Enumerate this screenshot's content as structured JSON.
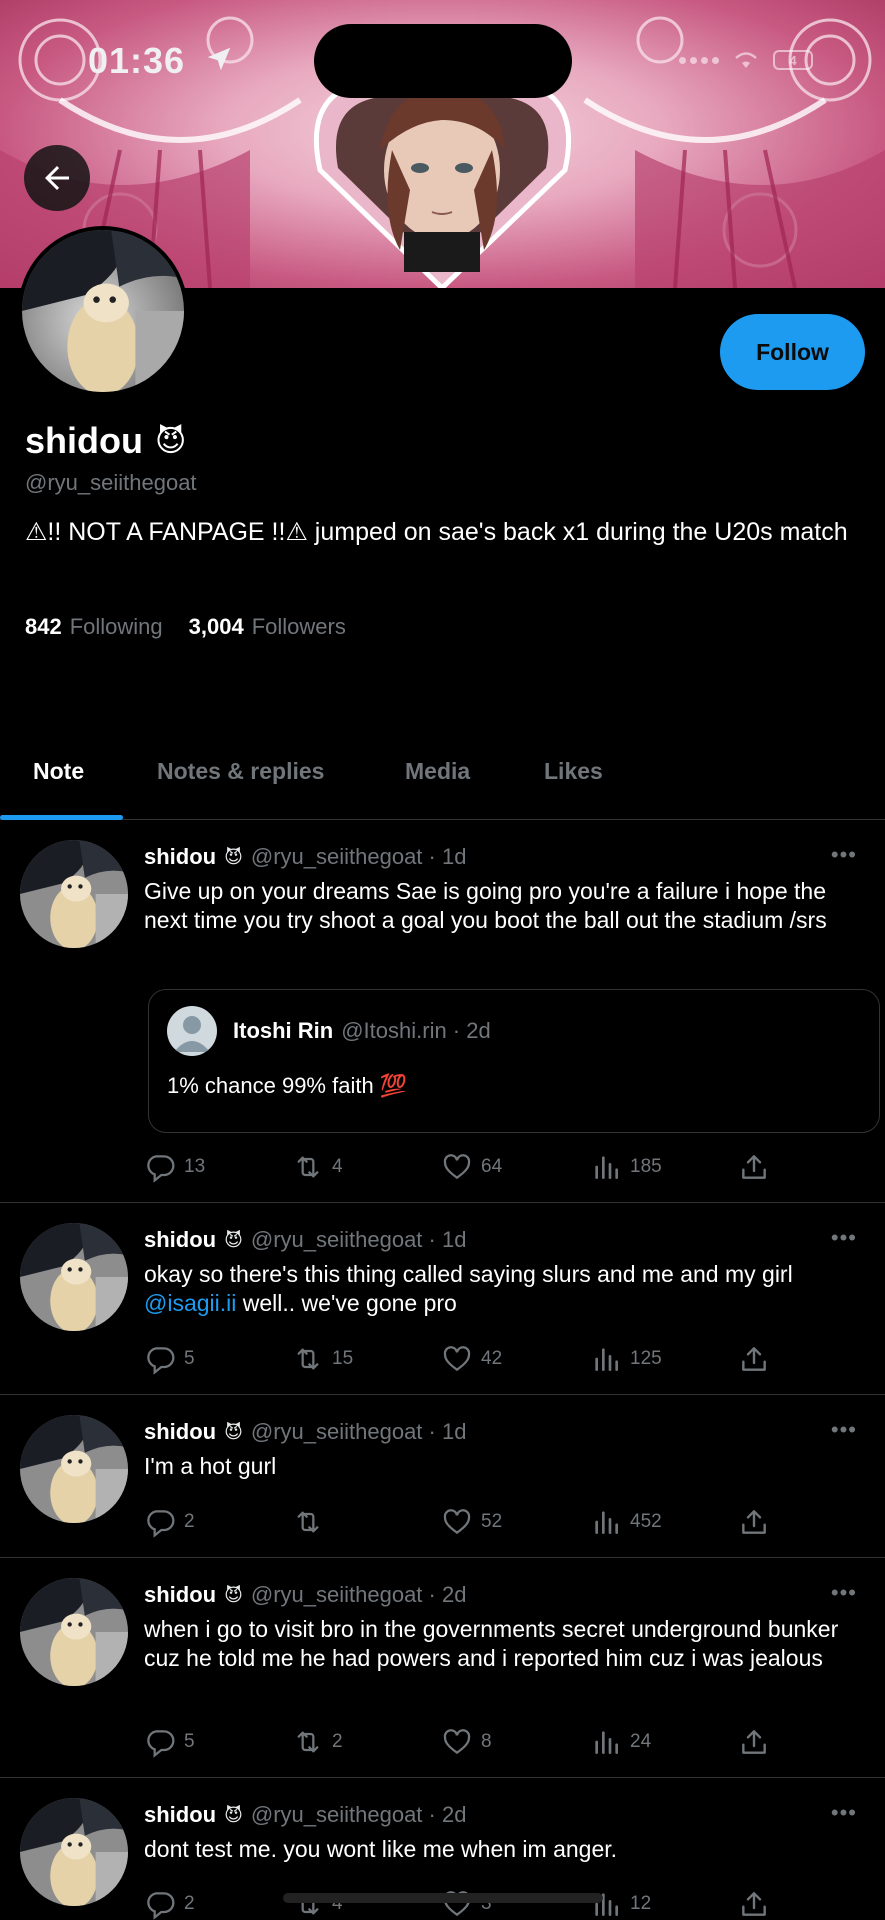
{
  "status_bar": {
    "time": "01:36",
    "battery": "4"
  },
  "profile": {
    "display_name": "shidou",
    "name_emoji": "😈",
    "handle": "@ryu_seiithegoat",
    "bio": "⚠!! NOT A FANPAGE !!⚠ jumped on sae's back x1 during the U20s match",
    "following_count": "842",
    "following_label": "Following",
    "followers_count": "3,004",
    "followers_label": "Followers",
    "follow_label": "Follow"
  },
  "tabs": [
    {
      "label": "Note"
    },
    {
      "label": "Notes & replies"
    },
    {
      "label": "Media"
    },
    {
      "label": "Likes"
    }
  ],
  "posts": [
    {
      "name": "shidou",
      "emoji": "😈",
      "handle": "@ryu_seiithegoat · 1d",
      "text": "Give up on your dreams Sae is going pro you're a failure i hope the next time you try shoot a goal you boot the ball out the stadium /srs",
      "quote": {
        "name": "Itoshi Rin",
        "handle": "@Itoshi.rin · 2d",
        "text": "1% chance 99% faith 💯"
      },
      "replies": "13",
      "reposts": "4",
      "likes": "64",
      "views": "185"
    },
    {
      "name": "shidou",
      "emoji": "😈",
      "handle": "@ryu_seiithegoat · 1d",
      "text_before": "okay so there's this thing called saying slurs and me and my girl ",
      "mention": "@isagii.ii",
      "text_after": " well.. we've gone pro",
      "replies": "5",
      "reposts": "15",
      "likes": "42",
      "views": "125"
    },
    {
      "name": "shidou",
      "emoji": "😈",
      "handle": "@ryu_seiithegoat · 1d",
      "text": "I'm a hot gurl",
      "replies": "2",
      "reposts": "",
      "likes": "52",
      "views": "452"
    },
    {
      "name": "shidou",
      "emoji": "😈",
      "handle": "@ryu_seiithegoat · 2d",
      "text": "when i go to visit bro in the governments secret underground bunker cuz he told me he had powers and i reported him cuz i was jealous",
      "replies": "5",
      "reposts": "2",
      "likes": "8",
      "views": "24"
    },
    {
      "name": "shidou",
      "emoji": "😈",
      "handle": "@ryu_seiithegoat · 2d",
      "text": "dont test me. you wont like me when im anger.",
      "replies": "2",
      "reposts": "4",
      "likes": "3",
      "views": "12"
    }
  ],
  "icons": {
    "back": "arrow-left-icon",
    "reply": "reply-icon",
    "repost": "repost-icon",
    "like": "heart-icon",
    "views": "views-icon",
    "share": "share-icon",
    "more": "more-icon"
  },
  "colors": {
    "accent": "#1d9bf0",
    "muted": "#71767b",
    "banner": "#c85a82"
  }
}
